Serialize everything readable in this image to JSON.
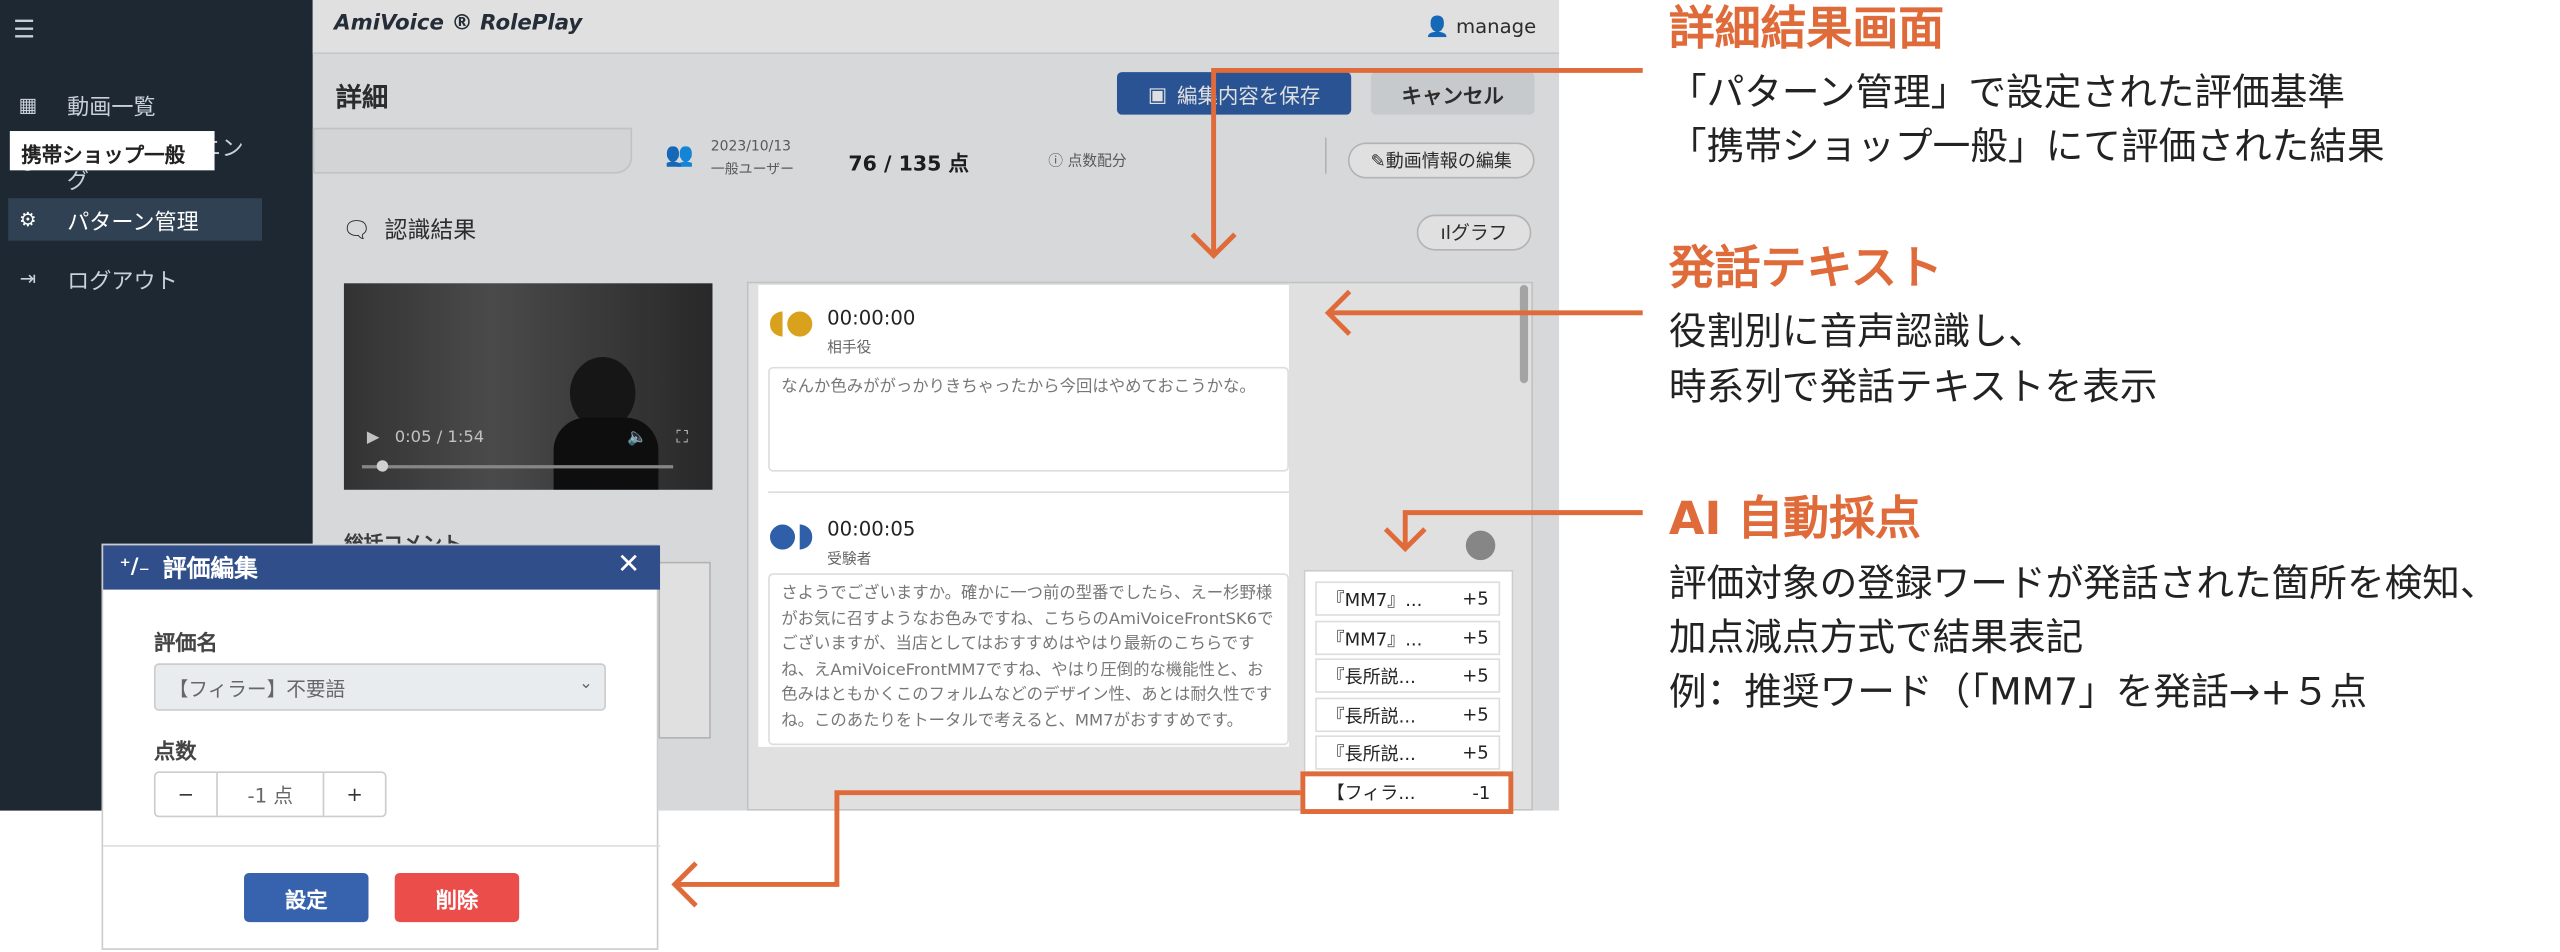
{
  "app": {
    "brand": "AmiVoice ® RolePlay",
    "user": "manage"
  },
  "sidebar": {
    "items": [
      {
        "label": "動画一覧",
        "icon": "film-icon"
      },
      {
        "label": "セルフトレーニング",
        "icon": "person-icon"
      },
      {
        "label": "パターン管理",
        "icon": "gear-icon"
      },
      {
        "label": "ログアウト",
        "icon": "logout-icon"
      }
    ]
  },
  "header": {
    "title": "詳細",
    "save_label": "編集内容を保存",
    "cancel_label": "キャンセル"
  },
  "info": {
    "pattern": "携帯ショップ一般",
    "date": "2023/10/13",
    "user_type": "一般ユーザー",
    "score": "76 / 135 点",
    "score_dist": "点数配分",
    "edit_video_label": "動画情報の編集"
  },
  "recognition": {
    "title": "認識結果",
    "graph_label": "グラフ",
    "video_time": "0:05 / 1:54",
    "comment_label": "総括コメント"
  },
  "transcript": [
    {
      "time": "00:00:00",
      "role": "相手役",
      "text": "なんか色みががっかりきちゃったから今回はやめておこうかな。"
    },
    {
      "time": "00:00:05",
      "role": "受験者",
      "text": "さようでございますか。確かに一つ前の型番でしたら、えー杉野様がお気に召すようなお色みですね、こちらのAmiVoiceFrontSK6でございますが、当店としてはおすすめはやはり最新のこちらですね、えAmiVoiceFrontMM7ですね、やはり圧倒的な機能性と、お色みはともかくこのフォルムなどのデザイン性、あとは耐久性ですね。このあたりをトータルで考えると、MM7がおすすめです。"
    }
  ],
  "scores": [
    {
      "label": "『MM7』...",
      "value": "+5"
    },
    {
      "label": "『MM7』...",
      "value": "+5"
    },
    {
      "label": "『長所説...",
      "value": "+5"
    },
    {
      "label": "『長所説...",
      "value": "+5"
    },
    {
      "label": "『長所説...",
      "value": "+5"
    },
    {
      "label": "【フィラ...",
      "value": "-1"
    }
  ],
  "modal": {
    "title": "評価編集",
    "name_label": "評価名",
    "name_value": "【フィラー】不要語",
    "points_label": "点数",
    "points_value": "-1 点",
    "minus": "−",
    "plus": "+",
    "set_label": "設定",
    "delete_label": "削除"
  },
  "annotations": [
    {
      "heading": "詳細結果画面",
      "lines": [
        "「パターン管理」で設定された評価基準",
        "「携帯ショップ一般」にて評価された結果"
      ]
    },
    {
      "heading": "発話テキスト",
      "lines": [
        "役割別に音声認識し、",
        "時系列で発話テキストを表示"
      ]
    },
    {
      "heading": "AI 自動採点",
      "lines": [
        "評価対象の登録ワードが発話された箇所を検知、",
        "加点減点方式で結果表記",
        "例：推奨ワード（「MM7」を発話→+５点"
      ]
    }
  ],
  "colors": {
    "accent": "#e06b3a",
    "sidebar": "#1e2833",
    "primary": "#2f5fa8",
    "danger": "#eb4d4b"
  }
}
